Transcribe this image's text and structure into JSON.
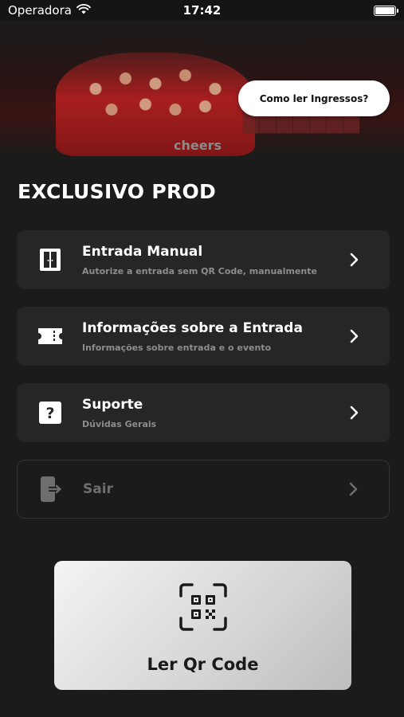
{
  "status_bar": {
    "carrier": "Operadora",
    "time": "17:42"
  },
  "banner": {
    "help_button_label": "Como ler Ingressos?",
    "brand_text": "cheers"
  },
  "page_title": "EXCLUSIVO PROD",
  "menu_items": [
    {
      "title": "Entrada Manual",
      "subtitle": "Autorize a entrada sem QR Code, manualmente",
      "icon": "door-icon",
      "enabled": true
    },
    {
      "title": "Informações sobre a Entrada",
      "subtitle": "Informações sobre entrada e o evento",
      "icon": "ticket-icon",
      "enabled": true
    },
    {
      "title": "Suporte",
      "subtitle": "Dúvidas Gerais",
      "icon": "question-icon",
      "enabled": true
    },
    {
      "title": "Sair",
      "subtitle": "",
      "icon": "logout-icon",
      "enabled": false
    }
  ],
  "qr_button": {
    "label": "Ler Qr Code",
    "icon": "qr-code-icon"
  },
  "colors": {
    "background": "#1b1b1b",
    "card": "#262626",
    "accent": "#b52020"
  }
}
